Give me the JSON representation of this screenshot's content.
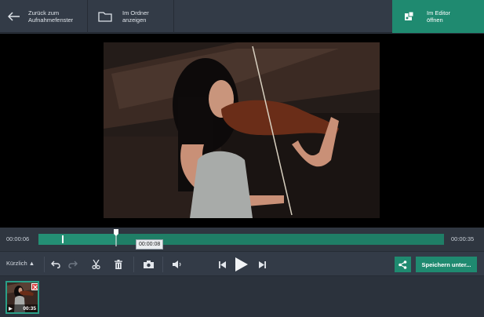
{
  "toolbar": {
    "back_label": "Zurück zum\nAufnahmefenster",
    "folder_label": "Im Ordner\nanzeigen",
    "editor_label": "Im Editor\nöffnen",
    "accent_color": "#1f8a70"
  },
  "player": {
    "time_start": "00:00:06",
    "time_end": "00:00:35",
    "tooltip_time": "00:00:08",
    "progress_fraction": 0.19
  },
  "controls": {
    "recent_label": "Kürzlich ▲",
    "save_label": "Speichern unter..."
  },
  "clip": {
    "duration": "00:35"
  }
}
